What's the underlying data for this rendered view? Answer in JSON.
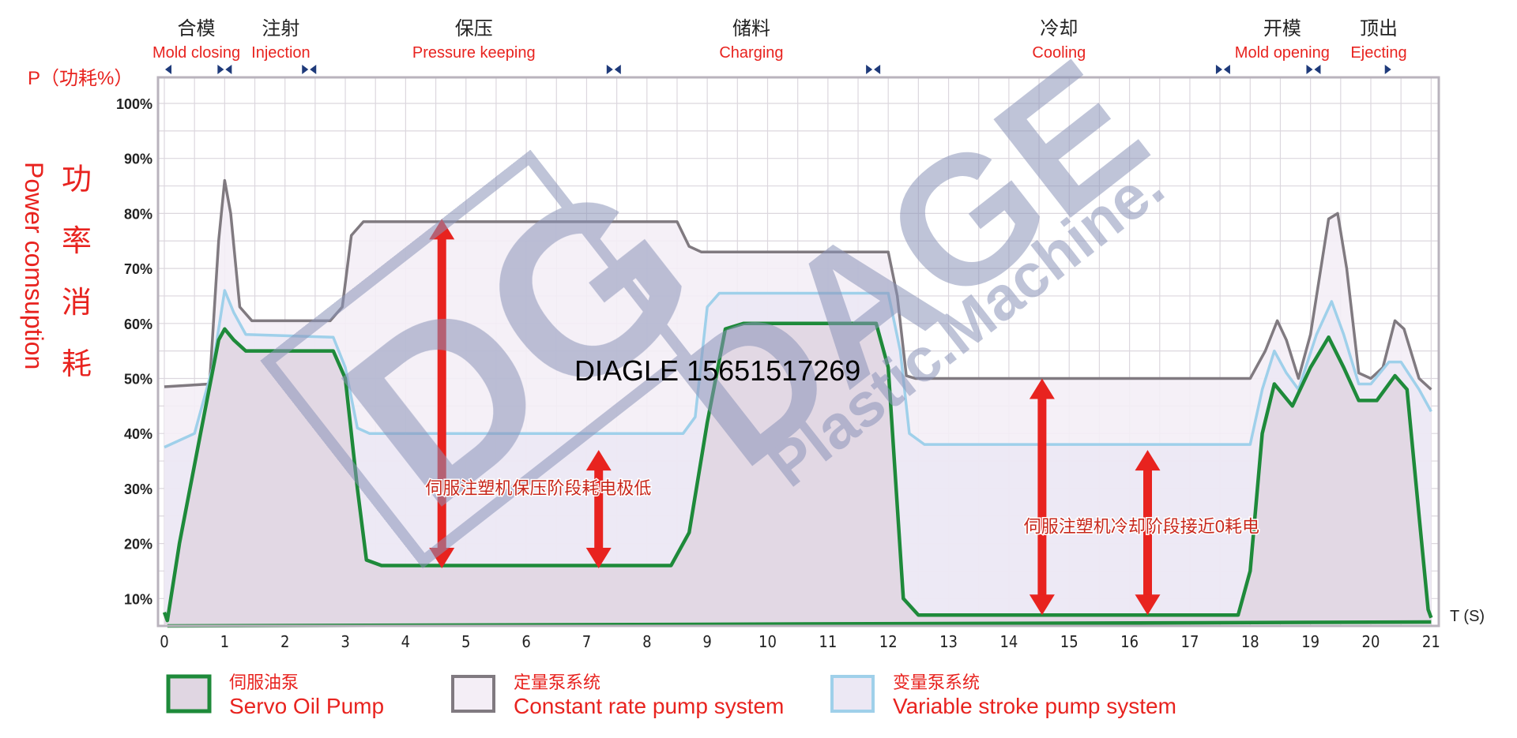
{
  "chart_data": {
    "type": "line",
    "y_axis_label_top": "P（功耗%）",
    "y_axis_title_cn": [
      "功",
      "率",
      "消",
      "耗"
    ],
    "y_axis_title_en": "Power comsuption",
    "x_axis_label": "T (S)",
    "xlim": [
      0,
      21
    ],
    "ylim": [
      5,
      104
    ],
    "x_ticks": [
      "0",
      "1",
      "2",
      "3",
      "4",
      "5",
      "6",
      "7",
      "8",
      "9",
      "10",
      "11",
      "12",
      "13",
      "14",
      "15",
      "16",
      "17",
      "18",
      "19",
      "20",
      "21"
    ],
    "y_ticks": [
      {
        "v": 100,
        "label": "100%"
      },
      {
        "v": 90,
        "label": "90%"
      },
      {
        "v": 80,
        "label": "80%"
      },
      {
        "v": 70,
        "label": "70%"
      },
      {
        "v": 60,
        "label": "60%"
      },
      {
        "v": 50,
        "label": "50%"
      },
      {
        "v": 40,
        "label": "40%"
      },
      {
        "v": 30,
        "label": "30%"
      },
      {
        "v": 20,
        "label": "20%"
      },
      {
        "v": 10,
        "label": "10%"
      }
    ],
    "grid": true,
    "phases": [
      {
        "cn": "合模",
        "en": "Mold closing",
        "t": 0.4
      },
      {
        "cn": "注射",
        "en": "Injection",
        "t": 1.8
      },
      {
        "cn": "保压",
        "en": "Pressure keeping",
        "t": 5.0
      },
      {
        "cn": "储料",
        "en": "Charging",
        "t": 9.6
      },
      {
        "cn": "冷却",
        "en": "Cooling",
        "t": 14.7
      },
      {
        "cn": "开模",
        "en": "Mold opening",
        "t": 18.4
      },
      {
        "cn": "顶出",
        "en": "Ejecting",
        "t": 20.0
      }
    ],
    "phase_boundaries": [
      0,
      1.0,
      2.4,
      7.45,
      11.75,
      17.55,
      19.05,
      20.35
    ],
    "series": [
      {
        "name_cn": "定量泵系统",
        "name": "Constant rate pump system",
        "color": "#807a80",
        "fill": "#f4eef6",
        "points": [
          [
            0,
            48.5
          ],
          [
            0.75,
            49
          ],
          [
            0.9,
            75
          ],
          [
            1.0,
            86
          ],
          [
            1.1,
            80
          ],
          [
            1.25,
            63
          ],
          [
            1.45,
            60.5
          ],
          [
            2.75,
            60.5
          ],
          [
            2.95,
            63
          ],
          [
            3.1,
            76
          ],
          [
            3.3,
            78.5
          ],
          [
            8.5,
            78.5
          ],
          [
            8.7,
            74
          ],
          [
            8.9,
            73
          ],
          [
            12.0,
            73
          ],
          [
            12.15,
            65
          ],
          [
            12.3,
            50.5
          ],
          [
            12.45,
            50
          ],
          [
            18.0,
            50
          ],
          [
            18.25,
            55
          ],
          [
            18.45,
            60.5
          ],
          [
            18.6,
            57
          ],
          [
            18.8,
            50
          ],
          [
            19.0,
            58
          ],
          [
            19.3,
            79
          ],
          [
            19.45,
            80
          ],
          [
            19.6,
            70
          ],
          [
            19.8,
            51
          ],
          [
            20.0,
            50
          ],
          [
            20.2,
            52
          ],
          [
            20.4,
            60.5
          ],
          [
            20.55,
            59
          ],
          [
            20.8,
            50
          ],
          [
            21,
            48
          ]
        ]
      },
      {
        "name_cn": "变量泵系统",
        "name": "Variable stroke pump system",
        "color": "#9fd0ea",
        "fill": "#ece8f4",
        "points": [
          [
            0,
            37.5
          ],
          [
            0.5,
            40
          ],
          [
            0.8,
            52
          ],
          [
            1.0,
            66
          ],
          [
            1.15,
            62
          ],
          [
            1.35,
            58
          ],
          [
            2.8,
            57.5
          ],
          [
            3.0,
            52
          ],
          [
            3.2,
            41
          ],
          [
            3.4,
            40
          ],
          [
            8.6,
            40
          ],
          [
            8.8,
            43
          ],
          [
            9.0,
            63
          ],
          [
            9.2,
            65.5
          ],
          [
            12.0,
            65.5
          ],
          [
            12.2,
            55
          ],
          [
            12.35,
            40
          ],
          [
            12.6,
            38
          ],
          [
            18.0,
            38
          ],
          [
            18.2,
            48
          ],
          [
            18.4,
            55
          ],
          [
            18.6,
            51
          ],
          [
            18.8,
            48
          ],
          [
            19.1,
            58
          ],
          [
            19.35,
            64
          ],
          [
            19.55,
            58
          ],
          [
            19.8,
            49
          ],
          [
            20.0,
            49
          ],
          [
            20.3,
            53
          ],
          [
            20.5,
            53
          ],
          [
            20.8,
            48
          ],
          [
            21,
            44
          ]
        ]
      },
      {
        "name_cn": "伺服油泵",
        "name": "Servo Oil Pump",
        "color": "#1e8a3a",
        "fill": "#e0d6e2",
        "points": [
          [
            0,
            7.5
          ],
          [
            0.05,
            6
          ],
          [
            0.25,
            20
          ],
          [
            0.6,
            40
          ],
          [
            0.9,
            57
          ],
          [
            1.0,
            59
          ],
          [
            1.15,
            57
          ],
          [
            1.35,
            55
          ],
          [
            2.8,
            55
          ],
          [
            3.0,
            50
          ],
          [
            3.2,
            30
          ],
          [
            3.35,
            17
          ],
          [
            3.6,
            16
          ],
          [
            8.4,
            16
          ],
          [
            8.7,
            22
          ],
          [
            9.0,
            42
          ],
          [
            9.3,
            59
          ],
          [
            9.6,
            60
          ],
          [
            11.8,
            60
          ],
          [
            12.0,
            52
          ],
          [
            12.25,
            10
          ],
          [
            12.5,
            7
          ],
          [
            17.8,
            7
          ],
          [
            18.0,
            15
          ],
          [
            18.2,
            40
          ],
          [
            18.4,
            49
          ],
          [
            18.7,
            45
          ],
          [
            19.0,
            52
          ],
          [
            19.3,
            57.5
          ],
          [
            19.55,
            52
          ],
          [
            19.8,
            46
          ],
          [
            20.1,
            46
          ],
          [
            20.4,
            50.5
          ],
          [
            20.6,
            48
          ],
          [
            20.8,
            25
          ],
          [
            20.95,
            8
          ],
          [
            21,
            6.5
          ]
        ]
      }
    ],
    "annotations": [
      {
        "text": "伺服注塑机保压阶段耗电极低",
        "t": 6.2,
        "p": 29
      },
      {
        "text": "伺服注塑机冷却阶段接近0耗电",
        "t": 16.2,
        "p": 22
      }
    ],
    "arrows": [
      {
        "t": 4.6,
        "from": 79,
        "to": 15.5
      },
      {
        "t": 7.2,
        "from": 37,
        "to": 15.5
      },
      {
        "t": 14.55,
        "from": 50,
        "to": 7
      },
      {
        "t": 16.3,
        "from": 37,
        "to": 7
      }
    ],
    "arrow_color": "#e8231f"
  },
  "overlay_text": "DIAGLE 15651517269",
  "watermark": {
    "brand": "DAGE",
    "sub": "Plastic.Machine.",
    "logo": "DG"
  }
}
